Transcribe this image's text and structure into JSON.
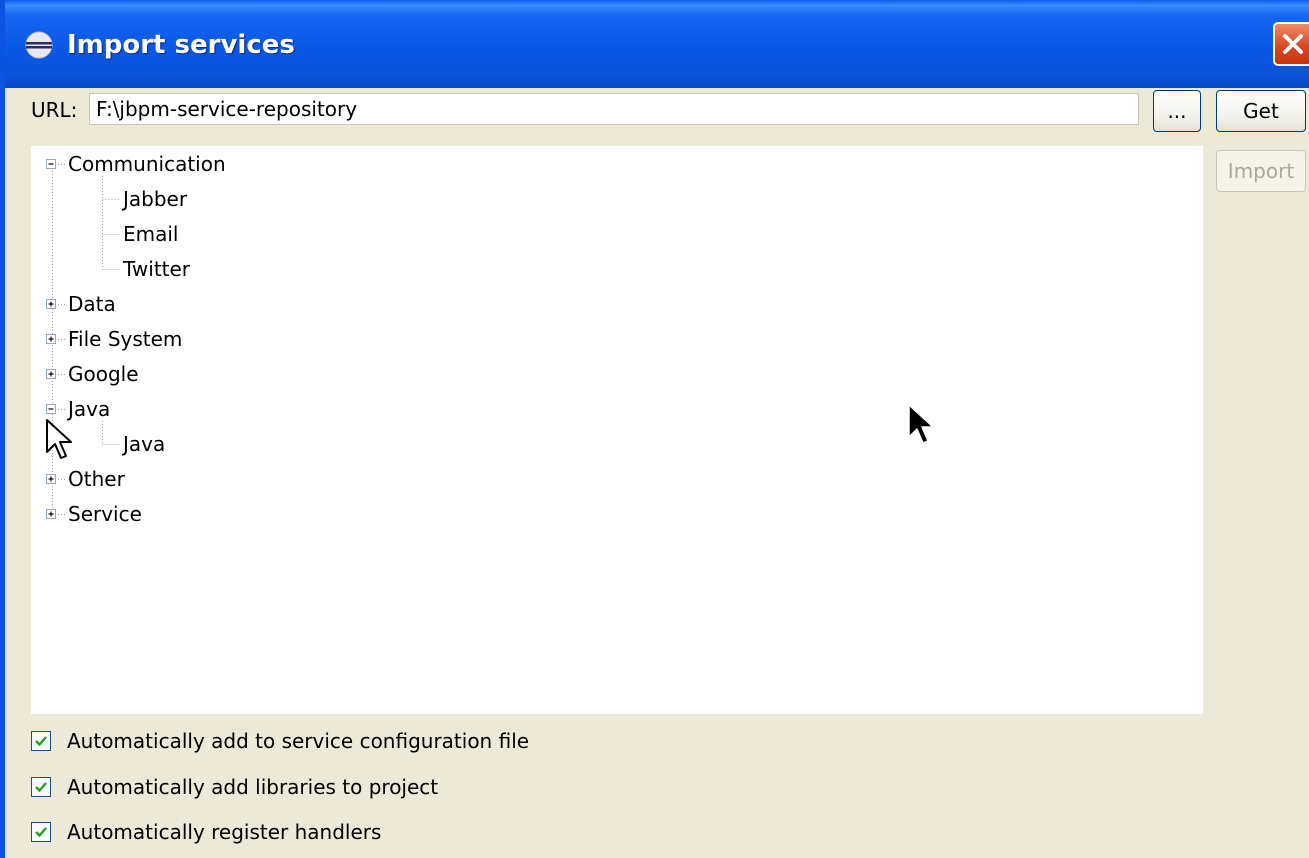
{
  "window": {
    "title": "Import services",
    "title_icon": "eclipse-icon",
    "close_icon": "close-icon",
    "accent_color": "#0a54e0"
  },
  "url_row": {
    "label": "URL:",
    "value": "F:\\jbpm-service-repository",
    "browse_label": "...",
    "get_label": "Get"
  },
  "actions": {
    "import_label": "Import",
    "import_enabled": false
  },
  "tree": {
    "items": [
      {
        "label": "Communication",
        "level": 0,
        "expanded": true
      },
      {
        "label": "Jabber",
        "level": 1
      },
      {
        "label": "Email",
        "level": 1
      },
      {
        "label": "Twitter",
        "level": 1
      },
      {
        "label": "Data",
        "level": 0,
        "expanded": false
      },
      {
        "label": "File System",
        "level": 0,
        "expanded": false
      },
      {
        "label": "Google",
        "level": 0,
        "expanded": false
      },
      {
        "label": "Java",
        "level": 0,
        "expanded": true
      },
      {
        "label": "Java",
        "level": 1
      },
      {
        "label": "Other",
        "level": 0,
        "expanded": false
      },
      {
        "label": "Service",
        "level": 0,
        "expanded": false
      }
    ]
  },
  "options": [
    {
      "label": "Automatically add to service configuration file",
      "checked": true
    },
    {
      "label": "Automatically add libraries to project",
      "checked": true
    },
    {
      "label": "Automatically register handlers",
      "checked": true
    }
  ]
}
